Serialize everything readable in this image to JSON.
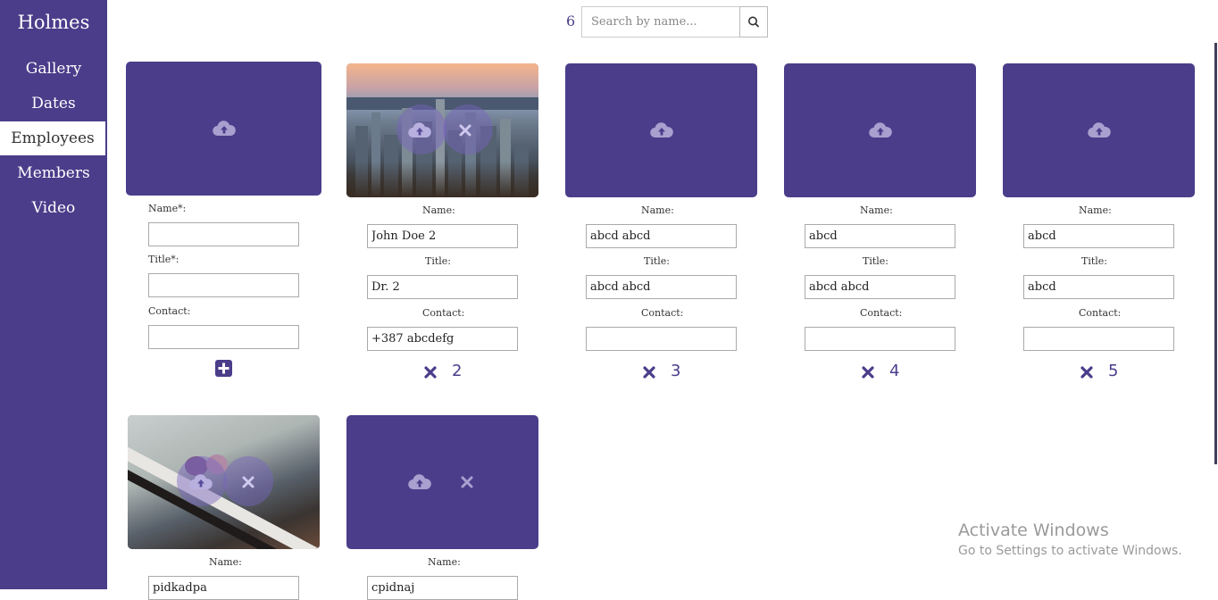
{
  "brand": "Holmes",
  "nav": [
    {
      "label": "Gallery"
    },
    {
      "label": "Dates"
    },
    {
      "label": "Employees",
      "active": true
    },
    {
      "label": "Members"
    },
    {
      "label": "Video"
    }
  ],
  "search": {
    "count": "6",
    "placeholder": "Search by name...",
    "value": ""
  },
  "labels": {
    "name_required": "Name*:",
    "title_required": "Title*:",
    "name": "Name:",
    "title": "Title:",
    "contact": "Contact:"
  },
  "new_employee": {
    "name": "",
    "title": "",
    "contact": ""
  },
  "employees": [
    {
      "id": "2",
      "name": "John Doe 2",
      "title": "Dr. 2",
      "contact": "+387 abcdefg",
      "photo": "city-skyline"
    },
    {
      "id": "3",
      "name": "abcd abcd",
      "title": "abcd abcd",
      "contact": "",
      "photo": "none"
    },
    {
      "id": "4",
      "name": "abcd",
      "title": "abcd abcd",
      "contact": "",
      "photo": "none"
    },
    {
      "id": "5",
      "name": "abcd",
      "title": "abcd",
      "contact": "",
      "photo": "none"
    },
    {
      "name": "pidkadpa",
      "photo": "piano-flowers"
    },
    {
      "name": "cpidnaj",
      "photo": "none"
    }
  ],
  "watermark": {
    "title": "Activate Windows",
    "subtitle": "Go to Settings to activate Windows."
  },
  "colors": {
    "brand": "#4b3d8a",
    "overlay_icon": "#a9a0cf"
  },
  "icons": {
    "upload": "cloud-upload-icon",
    "remove": "close-icon",
    "add": "plus-square-icon",
    "search": "search-icon"
  }
}
